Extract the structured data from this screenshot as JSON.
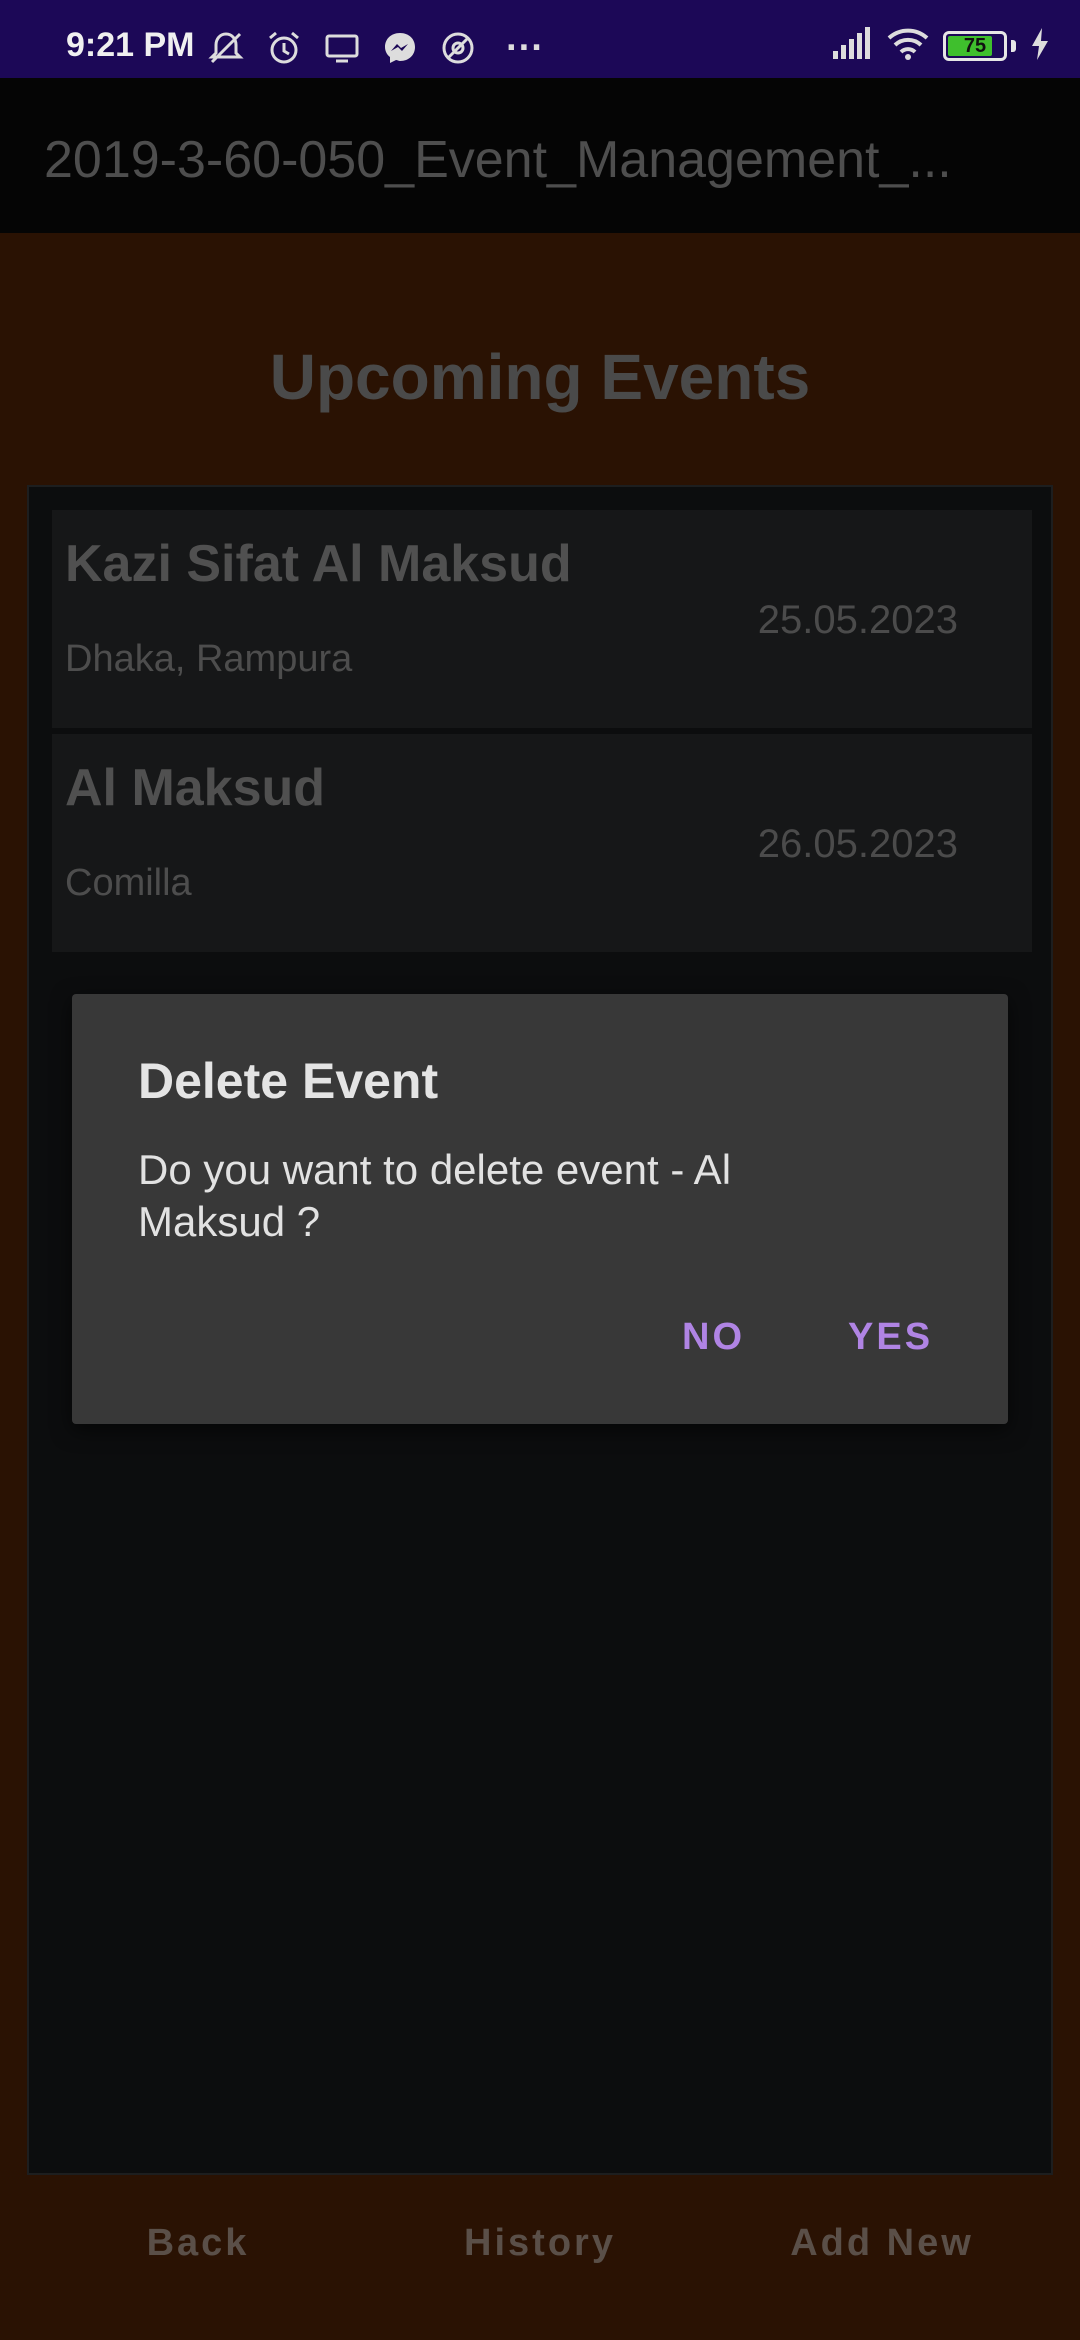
{
  "status_bar": {
    "time": "9:21 PM",
    "battery_level": "75",
    "icons": [
      "mute-icon",
      "alarm-icon",
      "screen-icon",
      "messenger-icon",
      "at-icon",
      "more-icon",
      "signal-icon",
      "wifi-icon",
      "battery-icon",
      "charging-icon"
    ],
    "more_glyph": "···"
  },
  "app_bar": {
    "title": "2019-3-60-050_Event_Management_..."
  },
  "page": {
    "heading": "Upcoming Events"
  },
  "events": [
    {
      "name": "Kazi Sifat Al Maksud",
      "place": "Dhaka, Rampura",
      "date": "25.05.2023"
    },
    {
      "name": "Al Maksud",
      "place": "Comilla",
      "date": "26.05.2023"
    }
  ],
  "dialog": {
    "title": "Delete Event",
    "message": "Do you want to delete event - Al Maksud ?",
    "no_label": "NO",
    "yes_label": "YES",
    "accent_color": "#b084e4"
  },
  "bottom_nav": {
    "back_label": "Back",
    "history_label": "History",
    "add_label": "Add New"
  },
  "colors": {
    "status_bar": "#1c0857",
    "background": "#2a1203",
    "app_bar": "#050505"
  }
}
